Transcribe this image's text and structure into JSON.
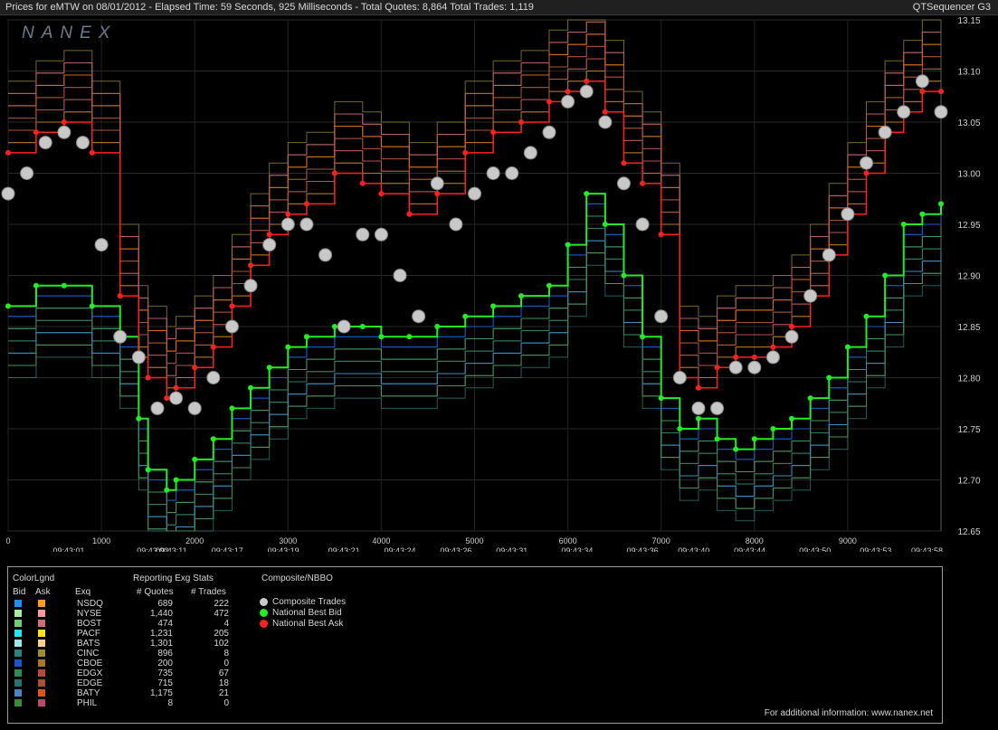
{
  "header": {
    "title": "Prices for  eMTW  on  08/01/2012  -  Elapsed Time: 59 Seconds, 925 Milliseconds  -  Total Quotes: 8,864  Total Trades: 1,119",
    "app": "QTSequencer G3"
  },
  "watermark": "NANEX",
  "chart_data": {
    "type": "line",
    "title": "",
    "xlabel": "",
    "ylabel": "",
    "xlim": [
      0,
      10000
    ],
    "ylim": [
      12.65,
      13.15
    ],
    "grid": true,
    "y_ticks": [
      12.65,
      12.7,
      12.75,
      12.8,
      12.85,
      12.9,
      12.95,
      13.0,
      13.05,
      13.1,
      13.15
    ],
    "y_tick_labels": [
      "12.65",
      "12.70",
      "12.75",
      "12.80",
      "12.85",
      "12.90",
      "12.95",
      "13.00",
      "13.05",
      "13.10",
      "13.15"
    ],
    "x_ticks": [
      0,
      1000,
      2000,
      3000,
      4000,
      5000,
      6000,
      7000,
      8000,
      9000
    ],
    "x_tick_labels": [
      "0",
      "1000",
      "2000",
      "3000",
      "4000",
      "5000",
      "6000",
      "7000",
      "8000",
      "9000"
    ],
    "time_labels": [
      {
        "x": 650,
        "label": "09:43:01"
      },
      {
        "x": 1550,
        "label": "09:43:02"
      },
      {
        "x": 1750,
        "label": "09:43:11"
      },
      {
        "x": 2350,
        "label": "09:43:17"
      },
      {
        "x": 2950,
        "label": "09:43:19"
      },
      {
        "x": 3600,
        "label": "09:43:21"
      },
      {
        "x": 4200,
        "label": "09:43:24"
      },
      {
        "x": 4800,
        "label": "09:43:26"
      },
      {
        "x": 5400,
        "label": "09:43:31"
      },
      {
        "x": 6100,
        "label": "09:43:34"
      },
      {
        "x": 6800,
        "label": "09:43:36"
      },
      {
        "x": 7350,
        "label": "09:43:40"
      },
      {
        "x": 7950,
        "label": "09:43:44"
      },
      {
        "x": 8650,
        "label": "09:43:50"
      },
      {
        "x": 9300,
        "label": "09:43:53"
      },
      {
        "x": 9850,
        "label": "09:43:58"
      }
    ],
    "series": [
      {
        "name": "National Best Bid",
        "color": "#22ee22",
        "x": [
          0,
          300,
          600,
          900,
          1200,
          1400,
          1500,
          1700,
          1800,
          2000,
          2200,
          2400,
          2600,
          2800,
          3000,
          3200,
          3500,
          3800,
          4000,
          4300,
          4600,
          4900,
          5200,
          5500,
          5800,
          6000,
          6200,
          6400,
          6600,
          6800,
          7000,
          7200,
          7400,
          7600,
          7800,
          8000,
          8200,
          8400,
          8600,
          8800,
          9000,
          9200,
          9400,
          9600,
          9800,
          10000
        ],
        "values": [
          12.87,
          12.89,
          12.89,
          12.87,
          12.84,
          12.76,
          12.71,
          12.69,
          12.7,
          12.72,
          12.74,
          12.77,
          12.79,
          12.81,
          12.83,
          12.84,
          12.85,
          12.85,
          12.84,
          12.84,
          12.85,
          12.86,
          12.87,
          12.88,
          12.89,
          12.93,
          12.98,
          12.95,
          12.9,
          12.84,
          12.78,
          12.75,
          12.76,
          12.74,
          12.73,
          12.74,
          12.75,
          12.76,
          12.78,
          12.8,
          12.83,
          12.86,
          12.9,
          12.95,
          12.96,
          12.97
        ]
      },
      {
        "name": "National Best Ask",
        "color": "#ff2020",
        "x": [
          0,
          300,
          600,
          900,
          1200,
          1400,
          1500,
          1700,
          1800,
          2000,
          2200,
          2400,
          2600,
          2800,
          3000,
          3200,
          3500,
          3800,
          4000,
          4300,
          4600,
          4900,
          5200,
          5500,
          5800,
          6000,
          6200,
          6400,
          6600,
          6800,
          7000,
          7200,
          7400,
          7600,
          7800,
          8000,
          8200,
          8400,
          8600,
          8800,
          9000,
          9200,
          9400,
          9600,
          9800,
          10000
        ],
        "values": [
          13.02,
          13.04,
          13.05,
          13.02,
          12.88,
          12.82,
          12.8,
          12.78,
          12.79,
          12.81,
          12.83,
          12.87,
          12.91,
          12.94,
          12.96,
          12.97,
          13.0,
          12.99,
          12.98,
          12.96,
          12.98,
          13.02,
          13.04,
          13.05,
          13.07,
          13.08,
          13.09,
          13.06,
          13.01,
          12.99,
          12.94,
          12.8,
          12.79,
          12.81,
          12.82,
          12.82,
          12.83,
          12.85,
          12.88,
          12.92,
          12.96,
          13.0,
          13.04,
          13.06,
          13.08,
          13.08
        ]
      },
      {
        "name": "Composite Trades",
        "color": "#c8c8c8",
        "x": [
          0,
          200,
          400,
          600,
          800,
          1000,
          1200,
          1400,
          1600,
          1800,
          2000,
          2200,
          2400,
          2600,
          2800,
          3000,
          3200,
          3400,
          3600,
          3800,
          4000,
          4200,
          4400,
          4600,
          4800,
          5000,
          5200,
          5400,
          5600,
          5800,
          6000,
          6200,
          6400,
          6600,
          6800,
          7000,
          7200,
          7400,
          7600,
          7800,
          8000,
          8200,
          8400,
          8600,
          8800,
          9000,
          9200,
          9400,
          9600,
          9800,
          10000
        ],
        "values": [
          12.98,
          13.0,
          13.03,
          13.04,
          13.03,
          12.93,
          12.84,
          12.82,
          12.77,
          12.78,
          12.77,
          12.8,
          12.85,
          12.89,
          12.93,
          12.95,
          12.95,
          12.92,
          12.85,
          12.94,
          12.94,
          12.9,
          12.86,
          12.99,
          12.95,
          12.98,
          13.0,
          13.0,
          13.02,
          13.04,
          13.07,
          13.08,
          13.05,
          12.99,
          12.95,
          12.86,
          12.8,
          12.77,
          12.77,
          12.81,
          12.81,
          12.82,
          12.84,
          12.88,
          12.92,
          12.96,
          13.01,
          13.04,
          13.06,
          13.09,
          13.06
        ]
      }
    ]
  },
  "legend": {
    "colorlgnd_title": "ColorLgnd",
    "bid_header": "Bid",
    "ask_header": "Ask",
    "exq_header": "Exq",
    "stats_title": "Reporting Exg Stats",
    "quotes_header": "# Quotes",
    "trades_header": "# Trades",
    "composite_title": "Composite/NBBO",
    "composite_items": [
      {
        "label": "Composite Trades",
        "color": "#c8c8c8"
      },
      {
        "label": "National Best Bid",
        "color": "#22ee22"
      },
      {
        "label": "National Best Ask",
        "color": "#ff2020"
      }
    ],
    "exchanges": [
      {
        "name": "NSDQ",
        "quotes": "689",
        "trades": "222",
        "bid": "#1f8fff",
        "ask": "#ff9a1a"
      },
      {
        "name": "NYSE",
        "quotes": "1,440",
        "trades": "472",
        "bid": "#a8f0a0",
        "ask": "#ff9aa0"
      },
      {
        "name": "BOST",
        "quotes": "474",
        "trades": "4",
        "bid": "#6fce6f",
        "ask": "#cc6f78"
      },
      {
        "name": "PACF",
        "quotes": "1,231",
        "trades": "205",
        "bid": "#22e8f0",
        "ask": "#ffe31a"
      },
      {
        "name": "BATS",
        "quotes": "1,301",
        "trades": "102",
        "bid": "#9ee6f2",
        "ask": "#ffd08a"
      },
      {
        "name": "CINC",
        "quotes": "896",
        "trades": "8",
        "bid": "#2c7f7a",
        "ask": "#9a8d33"
      },
      {
        "name": "CBOE",
        "quotes": "200",
        "trades": "0",
        "bid": "#1b56c8",
        "ask": "#a87a20"
      },
      {
        "name": "EDGX",
        "quotes": "735",
        "trades": "67",
        "bid": "#2e8a5a",
        "ask": "#b04a3a"
      },
      {
        "name": "EDGE",
        "quotes": "715",
        "trades": "18",
        "bid": "#2a7070",
        "ask": "#a8522a"
      },
      {
        "name": "BATY",
        "quotes": "1,175",
        "trades": "21",
        "bid": "#4a86c4",
        "ask": "#e0561a"
      },
      {
        "name": "PHIL",
        "quotes": "8",
        "trades": "0",
        "bid": "#3a8a3a",
        "ask": "#b84a6a"
      }
    ],
    "footer": "For additional information: www.nanex.net"
  }
}
